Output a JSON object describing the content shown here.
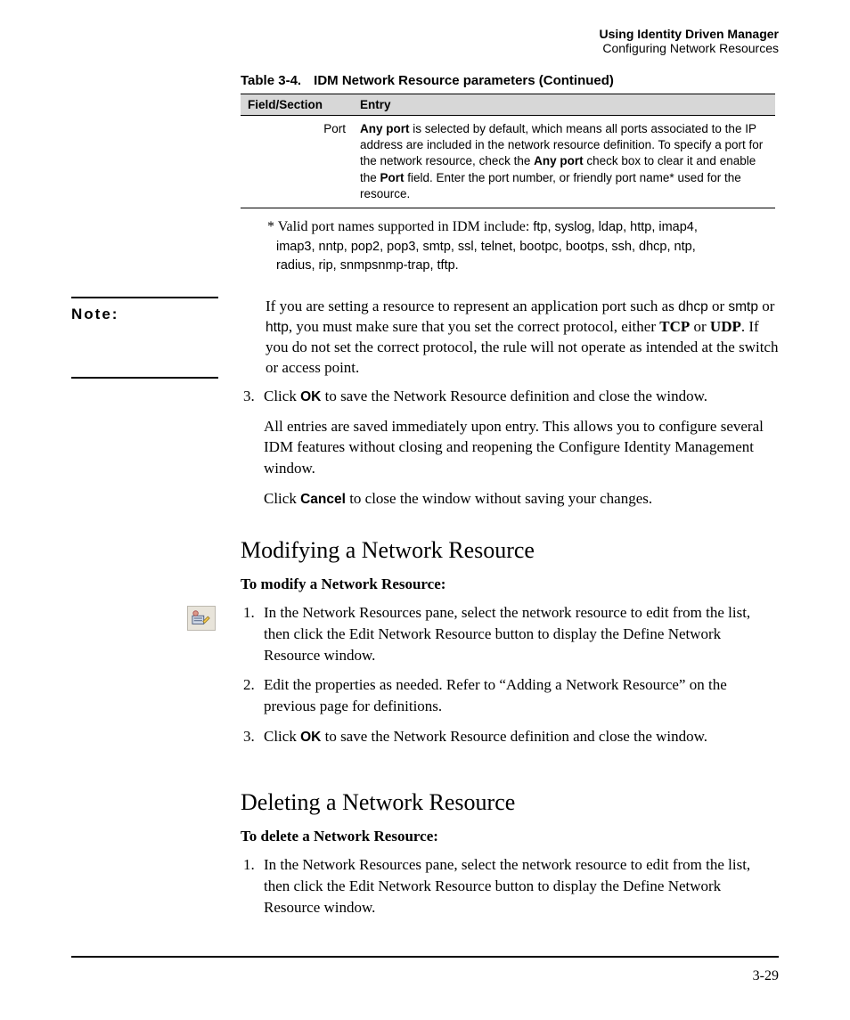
{
  "header": {
    "line1": "Using Identity Driven Manager",
    "line2": "Configuring Network Resources"
  },
  "table": {
    "caption_label": "Table 3-4.",
    "caption_text": "IDM Network Resource parameters (Continued)",
    "col1": "Field/Section",
    "col2": "Entry",
    "row_field": "Port",
    "row_entry_b1": "Any port",
    "row_entry_t1": " is selected by default, which means all ports associated to the IP address are included in the network resource definition. To specify a port for the network resource, check the ",
    "row_entry_b2": "Any port",
    "row_entry_t2": " check box to clear it and enable the ",
    "row_entry_b3": "Port",
    "row_entry_t3": " field. Enter the port number, or friendly port name* used for the resource."
  },
  "footnote": {
    "lead": "* Valid port names supported in IDM include: ",
    "names": "ftp, syslog, ldap, http, imap4, imap3, nntp, pop2, pop3, smtp, ssl, telnet, bootpc, bootps, ssh, dhcp, ntp, radius, rip, snmpsnmp-trap, tftp."
  },
  "note": {
    "label": "Note:",
    "t1": "If you are setting a resource to represent an application port such as ",
    "s1": "dhcp",
    "t2": " or ",
    "s2": "smtp",
    "t3": " or ",
    "s3": "http",
    "t4": ", you must make sure that you set the correct protocol, either ",
    "b1": "TCP",
    "t5": " or ",
    "b2": "UDP",
    "t6": ". If you do not set the correct protocol, the rule will not operate as intended at the switch or access point."
  },
  "steps_after_note": {
    "s3a": "Click ",
    "s3b": "OK",
    "s3c": " to save the Network Resource definition and close the window.",
    "para1": "All entries are saved immediately upon entry. This allows you to configure several IDM features without closing and reopening the Configure Identity Management window.",
    "para2a": "Click ",
    "para2b": "Cancel",
    "para2c": " to close the window without saving your changes."
  },
  "modify": {
    "heading": "Modifying a Network Resource",
    "subhead": "To modify a Network Resource:",
    "s1": "In the Network Resources pane, select the network resource to edit from the list, then click the Edit Network Resource button to display the Define Network Resource window.",
    "s2": "Edit the properties as needed. Refer to “Adding a Network Resource” on the previous page for definitions.",
    "s3a": "Click ",
    "s3b": "OK",
    "s3c": " to save the Network Resource definition and close the window."
  },
  "delete": {
    "heading": "Deleting a Network Resource",
    "subhead": "To delete a Network Resource:",
    "s1": "In the Network Resources pane, select the network resource to edit from the list, then click the Edit Network Resource button to display the Define Network Resource window."
  },
  "page_num": "3-29"
}
